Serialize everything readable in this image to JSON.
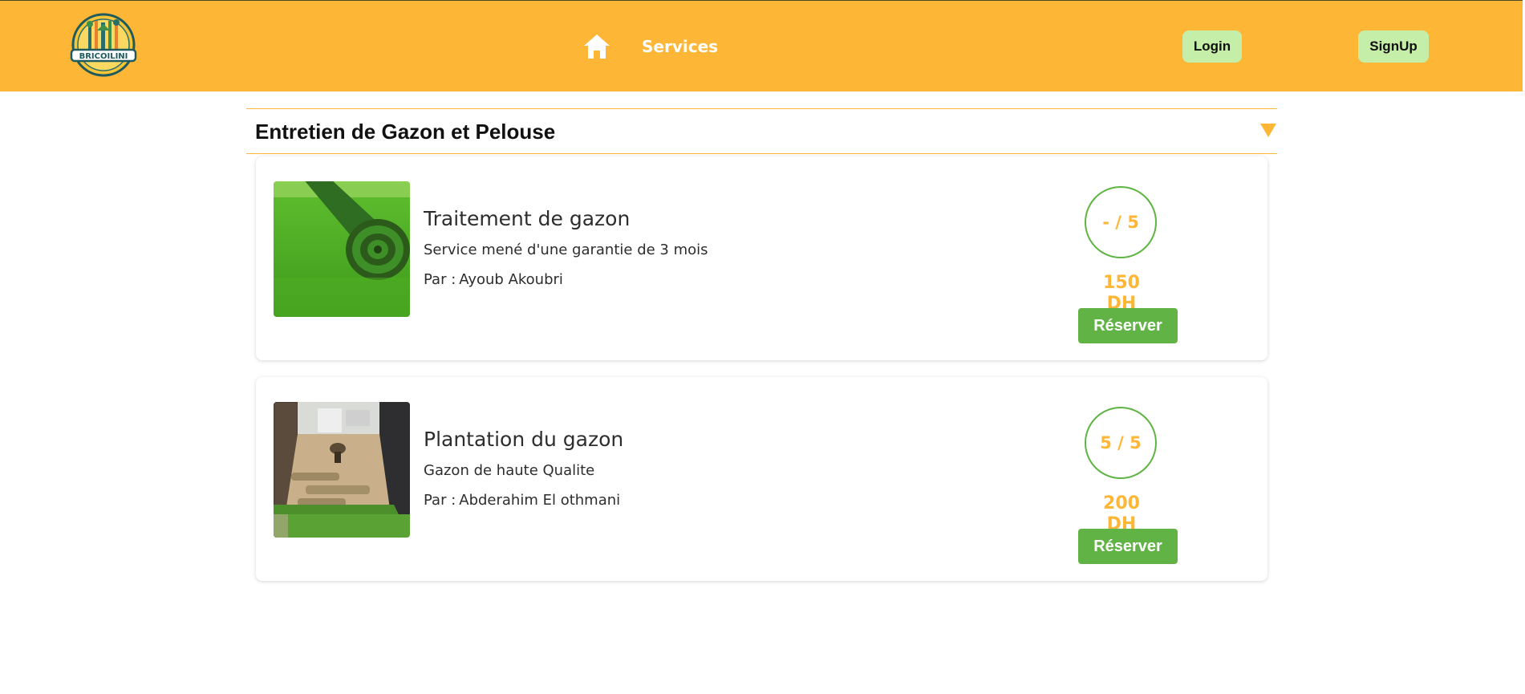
{
  "header": {
    "logo_text": "BRICOILINI",
    "nav": {
      "services_label": "Services"
    },
    "login_label": "Login",
    "signup_label": "SignUp"
  },
  "category": {
    "title": "Entretien de Gazon et Pelouse"
  },
  "services": [
    {
      "title": "Traitement de gazon",
      "description": "Service mené d'une garantie de 3 mois",
      "by_label": "Par :",
      "provider": "Ayoub Akoubri",
      "rating": "- / 5",
      "price": "150 DH",
      "reserve_label": "Réserver"
    },
    {
      "title": "Plantation du gazon",
      "description": "Gazon de haute Qualite",
      "by_label": "Par :",
      "provider": "Abderahim El othmani",
      "rating": "5 / 5",
      "price": "200 DH",
      "reserve_label": "Réserver"
    }
  ],
  "colors": {
    "header_bg": "#fdb636",
    "auth_button_bg": "#c5efa8",
    "accent_orange": "#fdb636",
    "accent_green": "#62b346"
  }
}
